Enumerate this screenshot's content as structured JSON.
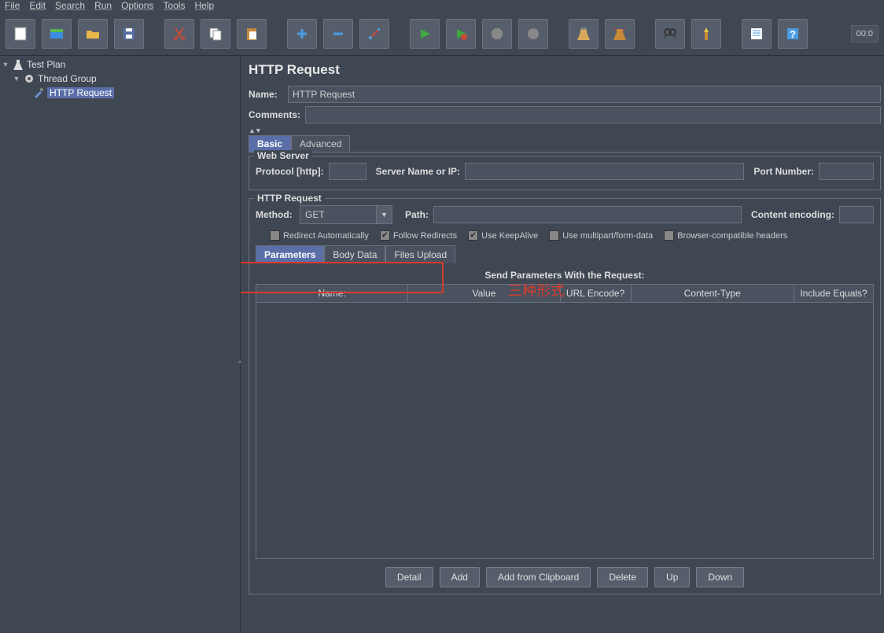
{
  "menubar": [
    "File",
    "Edit",
    "Search",
    "Run",
    "Options",
    "Tools",
    "Help"
  ],
  "timer": "00:0",
  "tree": {
    "test_plan": "Test Plan",
    "thread_group": "Thread Group",
    "http_request": "HTTP Request"
  },
  "page": {
    "title": "HTTP Request",
    "name_label": "Name:",
    "name_value": "HTTP Request",
    "comments_label": "Comments:",
    "tabs": {
      "basic": "Basic",
      "advanced": "Advanced"
    },
    "webserver": {
      "title": "Web Server",
      "protocol": "Protocol [http]:",
      "server": "Server Name or IP:",
      "port": "Port Number:"
    },
    "httpreq": {
      "title": "HTTP Request",
      "method_label": "Method:",
      "method_value": "GET",
      "path_label": "Path:",
      "encoding_label": "Content encoding:",
      "checks": {
        "redirect_auto": "Redirect Automatically",
        "follow_redirects": "Follow Redirects",
        "keepalive": "Use KeepAlive",
        "multipart": "Use multipart/form-data",
        "browser_compat": "Browser-compatible headers"
      }
    },
    "body_tabs": {
      "params": "Parameters",
      "body": "Body Data",
      "files": "Files Upload"
    },
    "annotation": "三种形式",
    "param_title": "Send Parameters With the Request:",
    "columns": {
      "name": "Name:",
      "value": "Value",
      "urlencode": "URL Encode?",
      "contenttype": "Content-Type",
      "include": "Include Equals?"
    },
    "buttons": {
      "detail": "Detail",
      "add": "Add",
      "clipboard": "Add from Clipboard",
      "delete": "Delete",
      "up": "Up",
      "down": "Down"
    }
  }
}
